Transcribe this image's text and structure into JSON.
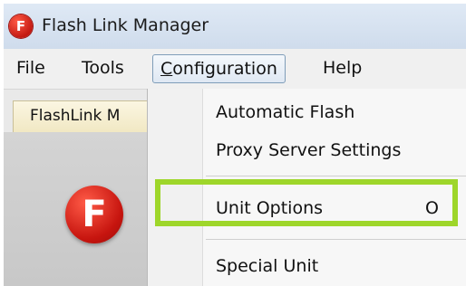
{
  "app": {
    "title": "Flash Link Manager",
    "logo_letter": "F"
  },
  "menubar": {
    "items": [
      {
        "label": "File"
      },
      {
        "label": "Tools"
      },
      {
        "label": "Configuration",
        "mnemonic": "C",
        "rest": "onfiguration",
        "state": "open"
      },
      {
        "label": "Help"
      }
    ]
  },
  "left_pane": {
    "tab_label": "FlashLink M",
    "logo_letter": "F"
  },
  "dropdown": {
    "items": [
      {
        "label": "Automatic Flash",
        "shortcut": ""
      },
      {
        "label": "Proxy Server Settings",
        "shortcut": ""
      },
      {
        "label": "Unit Options",
        "shortcut": "O",
        "highlighted": true
      },
      {
        "label": "Special Unit",
        "shortcut": ""
      }
    ]
  },
  "colors": {
    "highlight": "#9ed62a",
    "brand_red": "#c41a12"
  },
  "icons": {
    "app": "flashlink-logo-icon"
  }
}
